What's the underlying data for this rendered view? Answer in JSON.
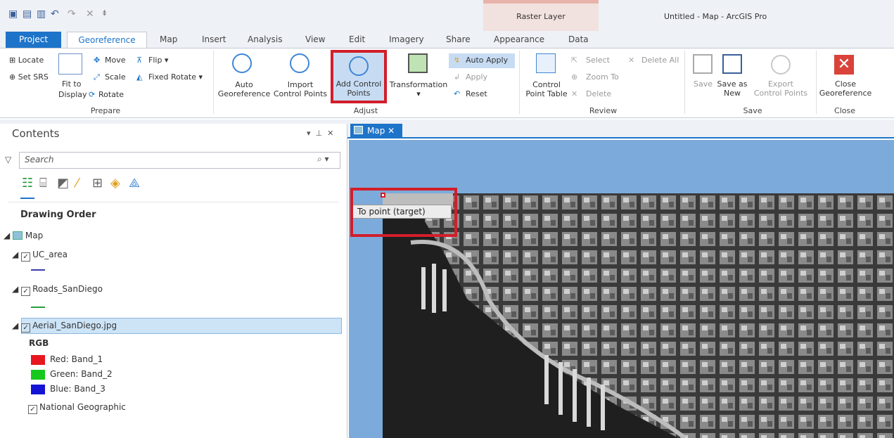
{
  "title_bar": {
    "contextual_group": "Raster Layer",
    "app_title": "Untitled - Map - ArcGIS Pro"
  },
  "tabs": [
    "Project",
    "Georeference",
    "Map",
    "Insert",
    "Analysis",
    "View",
    "Edit",
    "Imagery",
    "Share",
    "Appearance",
    "Data"
  ],
  "ribbon": {
    "prepare": {
      "label": "Prepare",
      "locate": "Locate",
      "set_srs": "Set SRS",
      "fit_to": "Fit to",
      "display": "Display",
      "move": "Move",
      "scale": "Scale",
      "rotate": "Rotate",
      "flip": "Flip",
      "fixed_rotate": "Fixed Rotate"
    },
    "adjust": {
      "label": "Adjust",
      "auto": "Auto",
      "georeference": "Georeference",
      "import": "Import",
      "control_points": "Control Points",
      "add_control": "Add Control",
      "points": "Points",
      "transformation": "Transformation",
      "auto_apply": "Auto Apply",
      "apply": "Apply",
      "reset": "Reset"
    },
    "review": {
      "label": "Review",
      "control": "Control",
      "point_table": "Point Table",
      "select": "Select",
      "zoom_to": "Zoom To",
      "delete": "Delete",
      "delete_all": "Delete All"
    },
    "save": {
      "label": "Save",
      "save": "Save",
      "save_as": "Save as",
      "new": "New",
      "export": "Export",
      "control_points": "Control Points"
    },
    "close": {
      "label": "Close",
      "close": "Close",
      "georeference": "Georeference"
    }
  },
  "contents": {
    "title": "Contents",
    "search_placeholder": "Search",
    "drawing_order": "Drawing Order",
    "map": "Map",
    "layers": [
      "UC_area",
      "Roads_SanDiego",
      "Aerial_SanDiego.jpg"
    ],
    "rgb": "RGB",
    "bands": [
      {
        "label": "Red:  Band_1",
        "color": "#e8161f"
      },
      {
        "label": "Green: Band_2",
        "color": "#17c81e"
      },
      {
        "label": "Blue:  Band_3",
        "color": "#1414d6"
      }
    ],
    "basemap": "National Geographic"
  },
  "map_view": {
    "tab": "Map",
    "tooltip": "To point (target)"
  },
  "colors": {
    "accent": "#1e74c9",
    "highlight": "#d11e2a",
    "water": "#7cabdb"
  }
}
